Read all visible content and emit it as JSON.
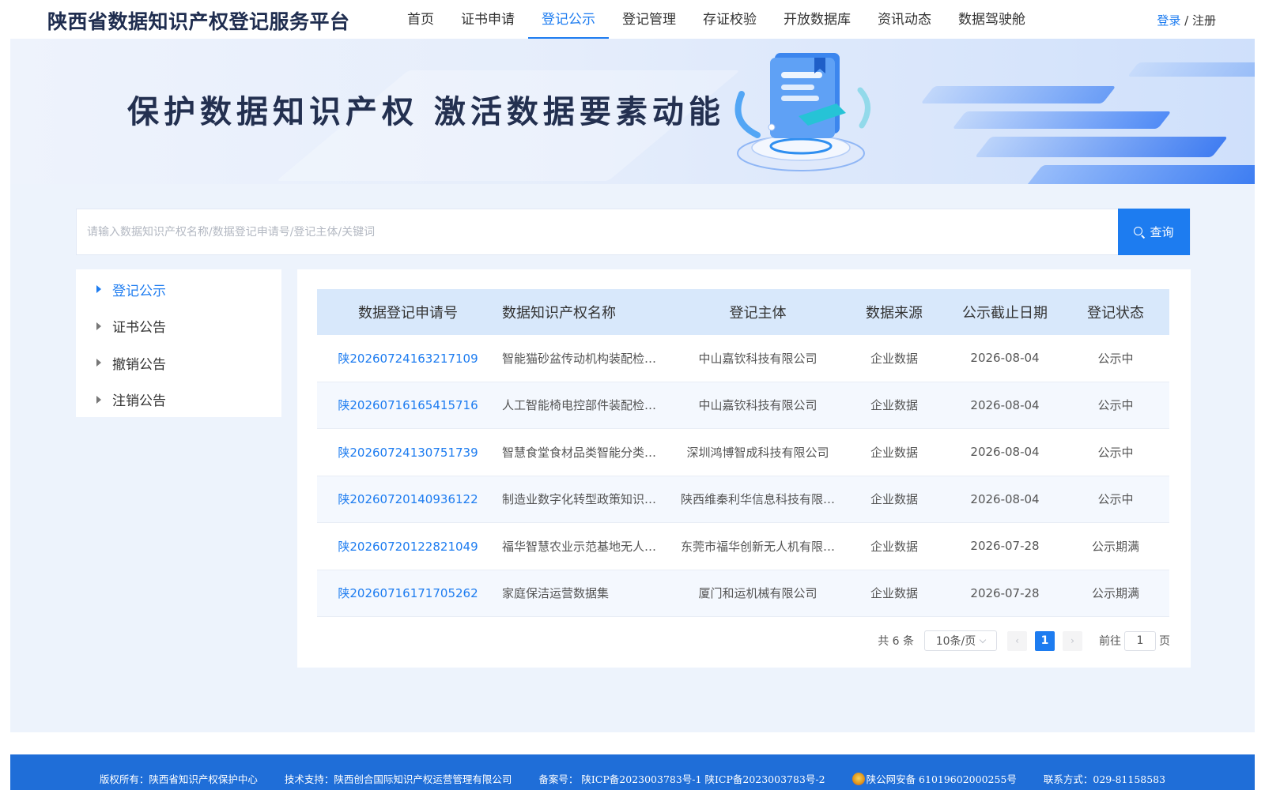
{
  "header": {
    "site_title": "陕西省数据知识产权登记服务平台",
    "nav": [
      {
        "label": "首页",
        "active": false
      },
      {
        "label": "证书申请",
        "active": false
      },
      {
        "label": "登记公示",
        "active": true
      },
      {
        "label": "登记管理",
        "active": false
      },
      {
        "label": "存证校验",
        "active": false
      },
      {
        "label": "开放数据库",
        "active": false
      },
      {
        "label": "资讯动态",
        "active": false
      },
      {
        "label": "数据驾驶舱",
        "active": false
      }
    ],
    "login": "登录",
    "separator": "/",
    "register": "注册"
  },
  "banner": {
    "slogan": "保护数据知识产权 激活数据要素动能"
  },
  "search": {
    "placeholder": "请输入数据知识产权名称/数据登记申请号/登记主体/关键词",
    "value": "",
    "button_label": "查询"
  },
  "sidebar": {
    "items": [
      {
        "label": "登记公示",
        "active": true
      },
      {
        "label": "证书公告",
        "active": false
      },
      {
        "label": "撤销公告",
        "active": false
      },
      {
        "label": "注销公告",
        "active": false
      }
    ]
  },
  "table": {
    "columns": [
      "数据登记申请号",
      "数据知识产权名称",
      "登记主体",
      "数据来源",
      "公示截止日期",
      "登记状态"
    ],
    "rows": [
      [
        "陕20260724163217109",
        "智能猫砂盆传动机构装配检…",
        "中山嘉钦科技有限公司",
        "企业数据",
        "2026-08-04",
        "公示中"
      ],
      [
        "陕20260716165415716",
        "人工智能椅电控部件装配检…",
        "中山嘉钦科技有限公司",
        "企业数据",
        "2026-08-04",
        "公示中"
      ],
      [
        "陕20260724130751739",
        "智慧食堂食材品类智能分类…",
        "深圳鸿博智成科技有限公司",
        "企业数据",
        "2026-08-04",
        "公示中"
      ],
      [
        "陕20260720140936122",
        "制造业数字化转型政策知识…",
        "陕西维秦利华信息科技有限…",
        "企业数据",
        "2026-08-04",
        "公示中"
      ],
      [
        "陕20260720122821049",
        "福华智慧农业示范基地无人…",
        "东莞市福华创新无人机有限…",
        "企业数据",
        "2026-07-28",
        "公示期满"
      ],
      [
        "陕20260716171705262",
        "家庭保洁运营数据集",
        "厦门和运机械有限公司",
        "企业数据",
        "2026-07-28",
        "公示期满"
      ]
    ]
  },
  "pagination": {
    "total_text": "共 6 条",
    "page_size": "10条/页",
    "prev": "‹",
    "current_page": "1",
    "next": "›",
    "goto_prefix": "前往",
    "goto_value": "1",
    "goto_suffix": "页"
  },
  "footer": {
    "copyright": "版权所有：陕西省知识产权保护中心",
    "tech_support": "技术支持：陕西创合国际知识产权运营管理有限公司",
    "icp": "备案号： 陕ICP备2023003783号-1 陕ICP备2023003783号-2",
    "police": "陕公网安备 61019602000255号",
    "contact": "联系方式：029-81158583"
  },
  "colors": {
    "accent": "#1d7cf0",
    "footer_bg": "#1f6ed8",
    "page_bg": "#edf3fc",
    "table_header_bg": "#d8e8fb"
  }
}
